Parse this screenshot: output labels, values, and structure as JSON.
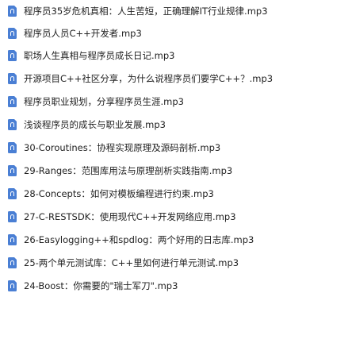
{
  "files": [
    {
      "name": "程序员35岁危机真相：人生苦短，正确理解IT行业规律.mp3",
      "icon": "audio-file-icon"
    },
    {
      "name": "程序员人员C++开发者.mp3",
      "icon": "audio-file-icon"
    },
    {
      "name": "职场人生真相与程序员成长日记.mp3",
      "icon": "audio-file-icon"
    },
    {
      "name": "开源项目C++社区分享，为什么说程序员们要学C++？.mp3",
      "icon": "audio-file-icon"
    },
    {
      "name": "程序员职业规划，分享程序员生涯.mp3",
      "icon": "audio-file-icon"
    },
    {
      "name": "浅谈程序员的成长与职业发展.mp3",
      "icon": "audio-file-icon"
    },
    {
      "name": "30-Coroutines：协程实现原理及源码剖析.mp3",
      "icon": "audio-file-icon"
    },
    {
      "name": "29-Ranges：范围库用法与原理剖析实践指南.mp3",
      "icon": "audio-file-icon"
    },
    {
      "name": "28-Concepts：如何对模板编程进行约束.mp3",
      "icon": "audio-file-icon"
    },
    {
      "name": "27-C-RESTSDK：使用现代C++开发网络应用.mp3",
      "icon": "audio-file-icon"
    },
    {
      "name": "26-Easylogging++和spdlog：两个好用的日志库.mp3",
      "icon": "audio-file-icon"
    },
    {
      "name": "25-两个单元测试库：C++里如何进行单元测试.mp3",
      "icon": "audio-file-icon"
    },
    {
      "name": "24-Boost：你需要的\"瑞士军刀\".mp3",
      "icon": "audio-file-icon"
    }
  ]
}
